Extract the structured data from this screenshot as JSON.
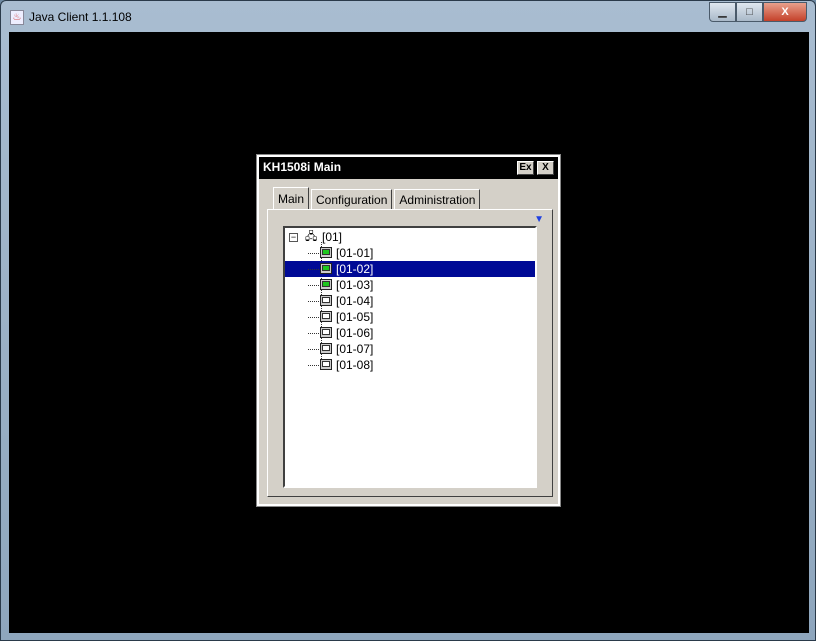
{
  "window": {
    "title": "Java Client 1.1.108",
    "buttons": {
      "minimize": "▁",
      "maximize": "□",
      "close": "X"
    }
  },
  "dialog": {
    "title": "KH1508i Main",
    "exit_label": "Ex",
    "close_label": "X"
  },
  "tabs": [
    {
      "label": "Main"
    },
    {
      "label": "Configuration"
    },
    {
      "label": "Administration"
    }
  ],
  "tree": {
    "root": "[01]",
    "selected": "[01-02]",
    "items": [
      {
        "label": "[01-01]",
        "online": true
      },
      {
        "label": "[01-02]",
        "online": true
      },
      {
        "label": "[01-03]",
        "online": true
      },
      {
        "label": "[01-04]",
        "online": false
      },
      {
        "label": "[01-05]",
        "online": false
      },
      {
        "label": "[01-06]",
        "online": false
      },
      {
        "label": "[01-07]",
        "online": false
      },
      {
        "label": "[01-08]",
        "online": false
      }
    ]
  }
}
